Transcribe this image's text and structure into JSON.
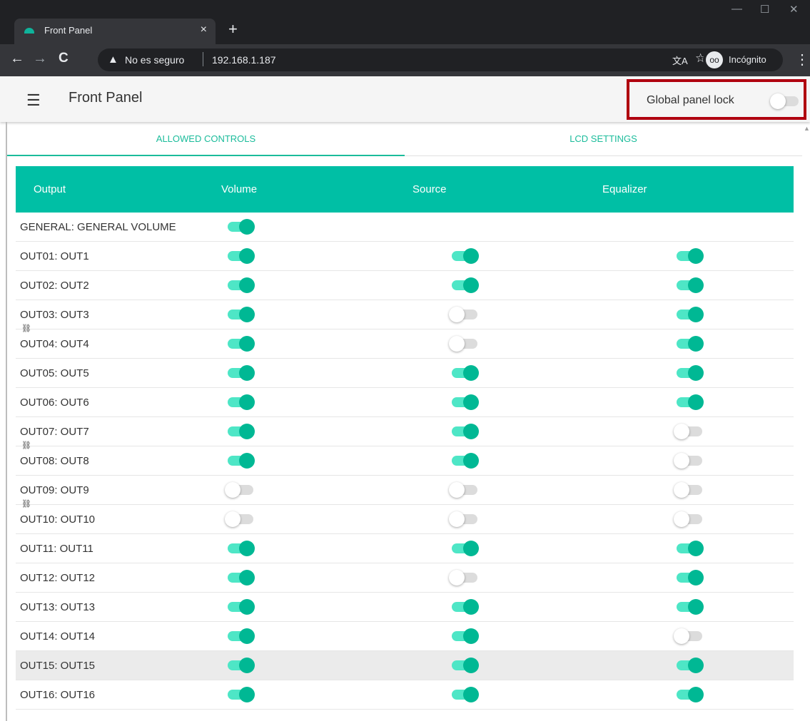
{
  "browser": {
    "tab_title": "Front Panel",
    "tab_close": "×",
    "new_tab": "+",
    "back": "←",
    "forward": "→",
    "reload": "C",
    "security_label": "No es seguro",
    "url": "192.168.1.187",
    "profile_label": "Incógnito",
    "minimize": "—",
    "maximize": "☐",
    "close": "✕"
  },
  "header": {
    "title": "Front Panel",
    "global_lock_label": "Global panel lock",
    "global_lock_on": false
  },
  "tabs": [
    {
      "label": "ALLOWED CONTROLS",
      "active": true
    },
    {
      "label": "LCD SETTINGS",
      "active": false
    }
  ],
  "table": {
    "columns": [
      "Output",
      "Volume",
      "Source",
      "Equalizer"
    ],
    "rows": [
      {
        "label": "GENERAL: GENERAL VOLUME",
        "volume": true,
        "source": null,
        "equalizer": null
      },
      {
        "label": "OUT01: OUT1",
        "volume": true,
        "source": true,
        "equalizer": true
      },
      {
        "label": "OUT02: OUT2",
        "volume": true,
        "source": true,
        "equalizer": true
      },
      {
        "label": "OUT03: OUT3",
        "volume": true,
        "source": false,
        "equalizer": true
      },
      {
        "label": "OUT04: OUT4",
        "volume": true,
        "source": false,
        "equalizer": true
      },
      {
        "label": "OUT05: OUT5",
        "volume": true,
        "source": true,
        "equalizer": true
      },
      {
        "label": "OUT06: OUT6",
        "volume": true,
        "source": true,
        "equalizer": true
      },
      {
        "label": "OUT07: OUT7",
        "volume": true,
        "source": true,
        "equalizer": false
      },
      {
        "label": "OUT08: OUT8",
        "volume": true,
        "source": true,
        "equalizer": false
      },
      {
        "label": "OUT09: OUT9",
        "volume": false,
        "source": false,
        "equalizer": false
      },
      {
        "label": "OUT10: OUT10",
        "volume": false,
        "source": false,
        "equalizer": false
      },
      {
        "label": "OUT11: OUT11",
        "volume": true,
        "source": true,
        "equalizer": true
      },
      {
        "label": "OUT12: OUT12",
        "volume": true,
        "source": false,
        "equalizer": true
      },
      {
        "label": "OUT13: OUT13",
        "volume": true,
        "source": true,
        "equalizer": true
      },
      {
        "label": "OUT14: OUT14",
        "volume": true,
        "source": true,
        "equalizer": false
      },
      {
        "label": "OUT15: OUT15",
        "volume": true,
        "source": true,
        "equalizer": true
      },
      {
        "label": "OUT16: OUT16",
        "volume": true,
        "source": true,
        "equalizer": true
      }
    ],
    "highlighted_row": 15,
    "linked_pairs_after_rows": [
      3,
      7,
      9
    ]
  },
  "icons": {
    "menu": "hamburger-icon",
    "link": "link-icon",
    "warning": "warning-icon",
    "star": "star-icon",
    "translate": "translate-icon",
    "incognito": "incognito-icon"
  },
  "colors": {
    "accent": "#00bfa5",
    "switch_on_knob": "#00b894",
    "switch_on_track": "#4ee6c6",
    "highlight_border": "#b0000f"
  }
}
